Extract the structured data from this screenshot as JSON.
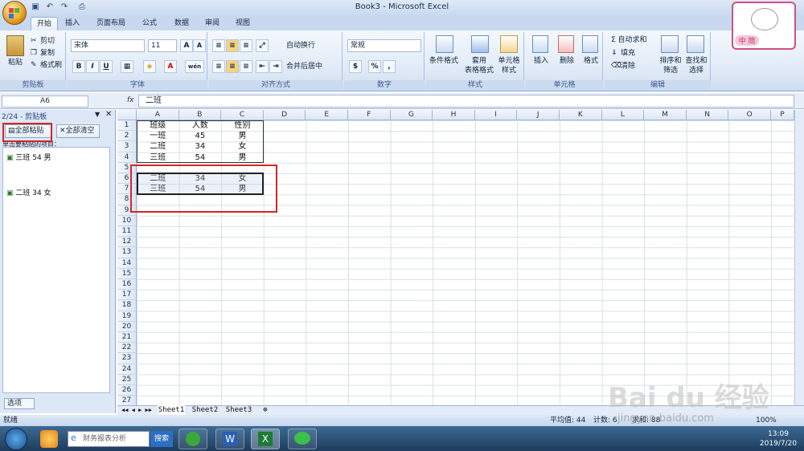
{
  "window": {
    "title": "Book3 - Microsoft Excel"
  },
  "ribbon": {
    "tabs": [
      "开始",
      "插入",
      "页面布局",
      "公式",
      "数据",
      "审阅",
      "视图"
    ],
    "clipboard": {
      "paste": "粘贴",
      "cut": "剪切",
      "copy": "复制",
      "format_painter": "格式刷",
      "label": "剪贴板"
    },
    "font": {
      "name": "宋体",
      "size": "11",
      "grow": "A",
      "shrink": "A",
      "bold": "B",
      "italic": "I",
      "underline": "U",
      "label": "字体",
      "font_color": "A",
      "phonetic": "wén"
    },
    "alignment": {
      "wrap": "自动换行",
      "merge": "合并后居中",
      "label": "对齐方式"
    },
    "number": {
      "format": "常规",
      "percent": "%",
      "comma": ",",
      "label": "数字"
    },
    "styles": {
      "conditional": "条件格式",
      "table": "套用\n表格格式",
      "cell": "单元格\n样式",
      "label": "样式"
    },
    "cells": {
      "insert": "插入",
      "delete": "删除",
      "format": "格式",
      "label": "单元格"
    },
    "editing": {
      "autosum": "Σ 自动求和",
      "fill": "填充",
      "clear": "清除",
      "sort": "排序和\n筛选",
      "find": "查找和\n选择",
      "label": "编辑"
    }
  },
  "formula_bar": {
    "name_box": "A6",
    "fx": "fx",
    "content": "二班"
  },
  "clipboard_pane": {
    "header": "2/24 - 剪贴板",
    "paste_all": "全部粘贴",
    "clear_all": "全部清空",
    "hint": "单击要粘贴的项目：",
    "items": [
      "三班 54 男",
      "二班 34 女"
    ],
    "options": "选项"
  },
  "sheet": {
    "columns": [
      "A",
      "B",
      "C",
      "D",
      "E",
      "F",
      "G",
      "H",
      "I",
      "J",
      "K",
      "L",
      "M",
      "N",
      "O",
      "P"
    ],
    "rows": [
      "1",
      "2",
      "3",
      "4",
      "5",
      "6",
      "7",
      "8",
      "9",
      "10",
      "11",
      "12",
      "13",
      "14",
      "15",
      "16",
      "17",
      "18",
      "19",
      "20",
      "21",
      "22",
      "23",
      "24",
      "25",
      "26",
      "27"
    ],
    "cells": [
      [
        "班级",
        "人数",
        "性别"
      ],
      [
        "一班",
        "45",
        "男"
      ],
      [
        "二班",
        "34",
        "女"
      ],
      [
        "三班",
        "54",
        "男"
      ],
      [
        "",
        "",
        ""
      ],
      [
        "二班",
        "34",
        "女"
      ],
      [
        "三班",
        "54",
        "男"
      ]
    ],
    "tabs": [
      "Sheet1",
      "Sheet2",
      "Sheet3"
    ]
  },
  "status": {
    "left": "就绪",
    "average": "平均值: 44",
    "count": "计数: 6",
    "sum": "求和: 88",
    "zoom": "100%"
  },
  "taskbar": {
    "search_placeholder": "财务报表分析",
    "search_btn": "搜索",
    "time": "13:09",
    "date": "2019/7/20"
  },
  "sticker": {
    "text": "中 简"
  },
  "watermark": {
    "brand": "Bai du 经验",
    "url": "jingyan.baidu.com"
  }
}
